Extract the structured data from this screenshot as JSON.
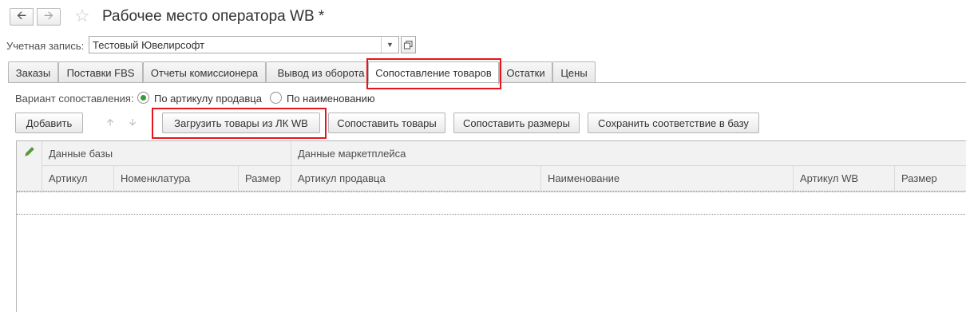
{
  "window": {
    "title": "Рабочее место оператора WB *"
  },
  "account": {
    "label": "Учетная запись:",
    "value": "Тестовый Ювелирсофт"
  },
  "tabs": [
    {
      "label": "Заказы"
    },
    {
      "label": "Поставки FBS"
    },
    {
      "label": "Отчеты комиссионера"
    },
    {
      "label": "Вывод из оборота"
    },
    {
      "label": "Сопоставление товаров",
      "active": true
    },
    {
      "label": "Остатки"
    },
    {
      "label": "Цены"
    }
  ],
  "match_variant": {
    "label": "Вариант сопоставления:",
    "options": [
      {
        "label": "По артикулу продавца",
        "selected": true
      },
      {
        "label": "По наименованию",
        "selected": false
      }
    ]
  },
  "toolbar": {
    "add": "Добавить",
    "load_from_wb": "Загрузить товары из ЛК WB",
    "match_goods": "Сопоставить товары",
    "match_sizes": "Сопоставить размеры",
    "save_mapping": "Сохранить соответствие в базу"
  },
  "grid": {
    "group_base": "Данные базы",
    "group_marketplace": "Данные маркетплейса",
    "columns": [
      "Артикул",
      "Номенклатура",
      "Размер",
      "Артикул продавца",
      "Наименование",
      "Артикул WB",
      "Размер"
    ]
  },
  "colors": {
    "highlight": "#e8141b",
    "radio_selected": "#3a9b3a"
  }
}
